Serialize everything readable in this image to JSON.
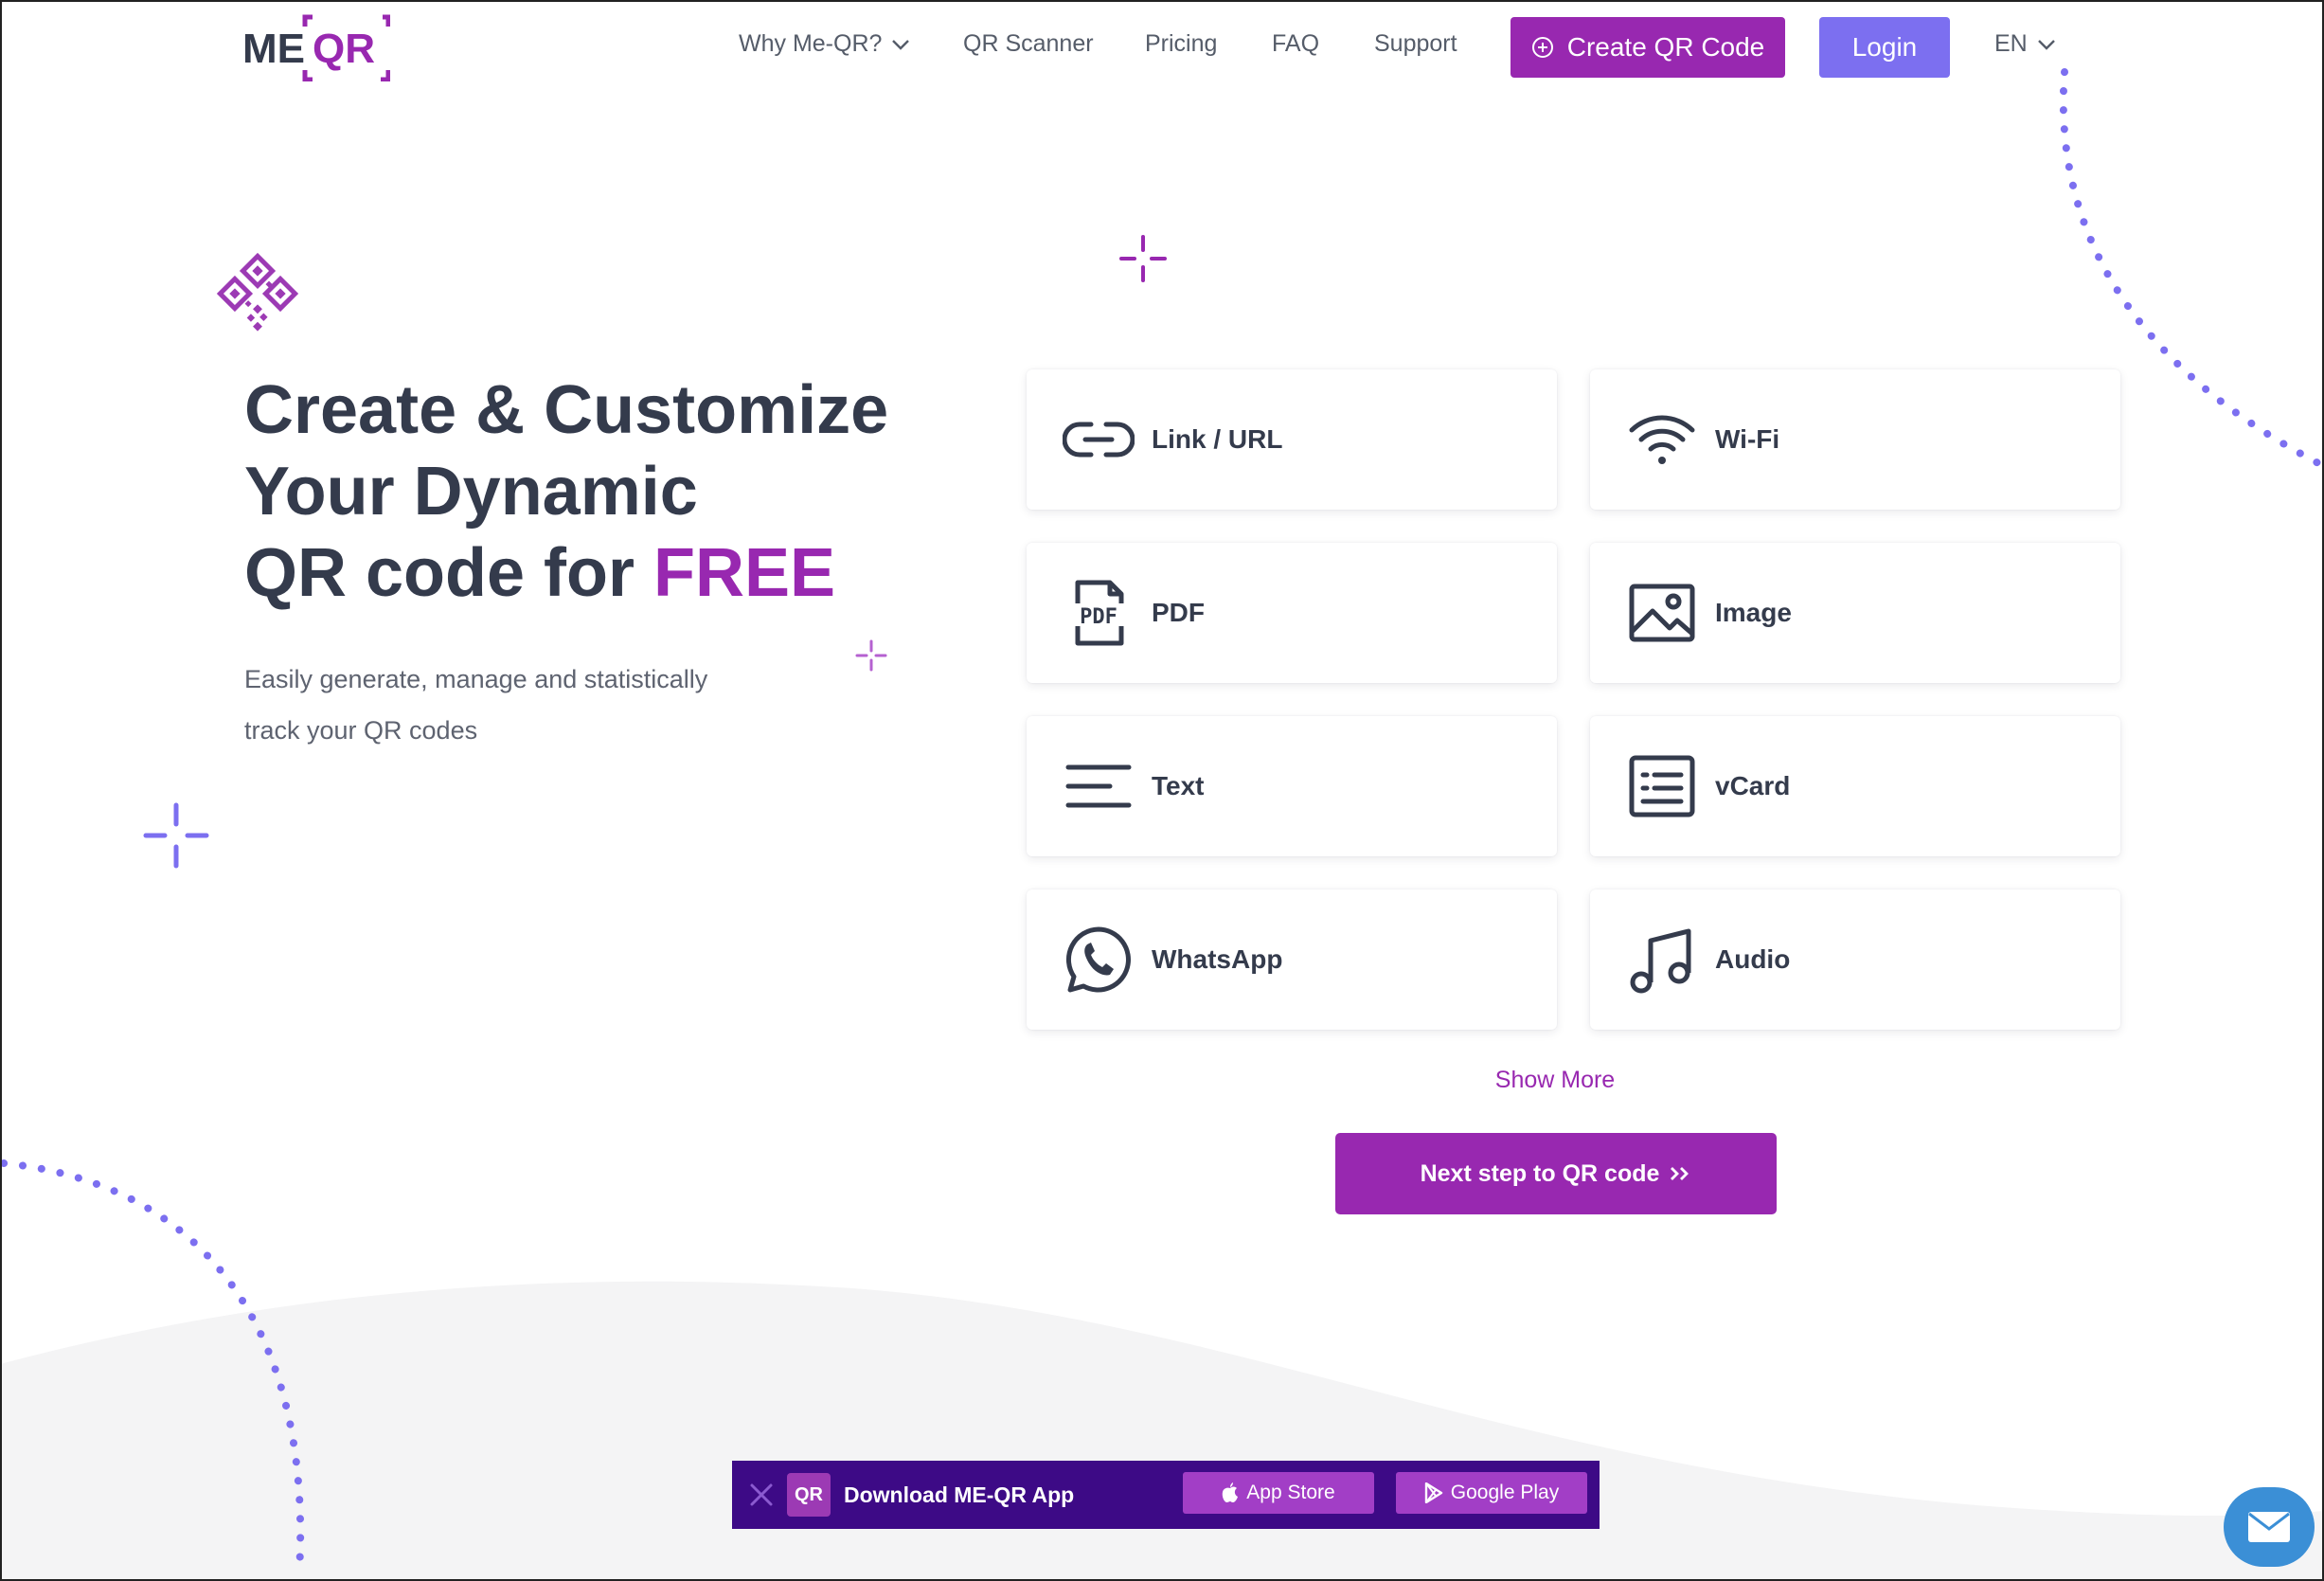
{
  "brand": {
    "logo_text_me": "ME",
    "logo_text_qr": "QR",
    "primary_color": "#9828b0",
    "secondary_color": "#7c6ff0"
  },
  "nav": {
    "items": [
      {
        "label": "Why Me-QR?"
      },
      {
        "label": "QR Scanner"
      },
      {
        "label": "Pricing"
      },
      {
        "label": "FAQ"
      },
      {
        "label": "Support"
      }
    ],
    "create_label": "Create QR Code",
    "login_label": "Login",
    "language": "EN"
  },
  "hero": {
    "title_line1": "Create & Customize",
    "title_line2": "Your Dynamic",
    "title_line3_prefix": "QR code for ",
    "title_line3_accent": "FREE",
    "subtitle_line1": "Easily generate, manage and statistically",
    "subtitle_line2": "track your QR codes"
  },
  "qr_types": [
    {
      "label": "Link / URL",
      "icon": "link-icon"
    },
    {
      "label": "Wi-Fi",
      "icon": "wifi-icon"
    },
    {
      "label": "PDF",
      "icon": "pdf-icon"
    },
    {
      "label": "Image",
      "icon": "image-icon"
    },
    {
      "label": "Text",
      "icon": "text-icon"
    },
    {
      "label": "vCard",
      "icon": "vcard-icon"
    },
    {
      "label": "WhatsApp",
      "icon": "whatsapp-icon"
    },
    {
      "label": "Audio",
      "icon": "audio-icon"
    }
  ],
  "pdf_icon_text": "PDF",
  "show_more_label": "Show More",
  "next_step_label": "Next step to QR code",
  "app_banner": {
    "logo_text": "QR",
    "text": "Download ME-QR App",
    "app_store_label": "App Store",
    "google_play_label": "Google Play",
    "background_color": "#3d0a86"
  }
}
